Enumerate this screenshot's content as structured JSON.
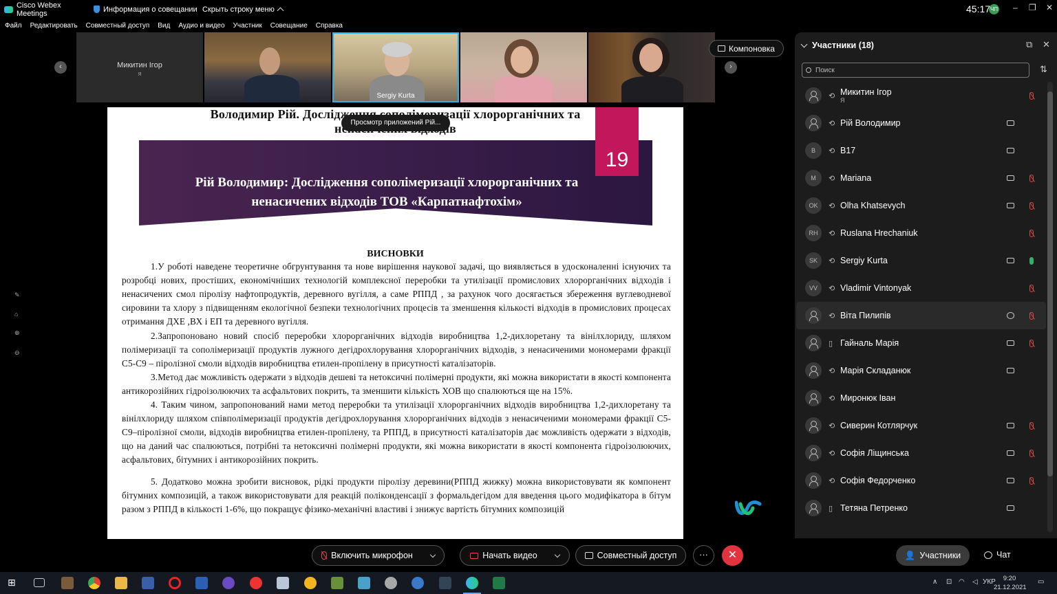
{
  "titlebar": {
    "app": "Cisco Webex Meetings",
    "info": "Информация о совещании",
    "hide_menu": "Скрыть строку меню",
    "time": "45:17",
    "rec_badge": "ЧП"
  },
  "menu": [
    "Файл",
    "Редактировать",
    "Совместный доступ",
    "Вид",
    "Аудио и видео",
    "Участник",
    "Совещание",
    "Справка"
  ],
  "videos": {
    "tile1_name": "Микитин Ігор",
    "tile1_sub": "Я",
    "tile3_name": "Sergiy Kurta"
  },
  "layout_button": "Компоновка",
  "tooltip": "Просмотр приложений Рій...",
  "slide": {
    "top_title_1": "Володимир Рій. Дослідження сополімеризації хлорорганічних та",
    "top_title_2": "ненасичених відходів",
    "number": "19",
    "banner_1": "Рій Володимир: Дослідження сополімеризації хлорорганічних та",
    "banner_2": "ненасичених відходів  ТОВ «Карпатнафтохім»",
    "conclusions": "ВИСНОВКИ",
    "p1": "1.У роботі наведене теоретичне обгрунтування та нове вирішення наукової задачі, що виявляється в удосконаленні існуючих та розробці нових, простіших, економічніших технологій комплексної переробки та  утилізації промислових хлорорганічних відходів  і ненасичених смол піролізу нафтопродуктів, деревного вугілля, а саме РППД , за рахунок чого досягається збереження вуглеводневої сировини та хлору з підвищенням екологічної безпеки технологічних процесів та зменшення кількості відходів в промислових процесах отримання ДХЕ ,ВХ і ЕП та деревного вугілля.",
    "p2": "2.Запропоновано новий спосіб переробки хлорорганічних відходів виробництва 1,2-дихлоретану та вінілхлориду, шляхом полімеризації та сополімеризації продуктів лужного дегідрохлорування хлорорганічних відходів, з  ненасиченими мономерами фракції C5-C9 – піролізної смоли відходів виробництва етилен-пропілену в присутності каталізаторів.",
    "p3": "3.Метод дає можливість одержати з відходів дешеві та нетоксичні полімерні продукти, які  можна використати в якості компонента антикорозійних гідроізолюючих та асфальтових покрить, та зменшити кількість ХОВ що спалюються ще на 15%.",
    "p4": "4. Таким чином, запропонований нами метод переробки та утилізації хлорорганічних відходів виробництва 1,2-дихлоретану та вінілхлориду шляхом співполімеризації продуктів дегідрохлорування хлорорганічних відходів з ненасиченими мономерами фракції C5-C9–піролізної смоли, відходів виробництва етилен-пропілену, та РППД, в присутності каталізаторів дає можливість одержати з відходів, що на даний час спалюються, потрібні та нетоксичні полімерні продукти, які  можна використати в якості компонента гідроізолюючих,  асфальтових, бітумних   і антикорозійних покрить.",
    "p5": "5. Додатково можна зробити висновок, рідкі продукти піролізу деревини(РППД жижку) можна використовувати як компонент бітумних композицій, а також використовувати для реакцій поліконденсації з формальдегідом для введення цього модифікатора в бітум разом з  РППД в кількості 1-6%, що покращує фізико-механічні властиві і знижує вартість бітумних композицій"
  },
  "panel": {
    "title": "Участники (18)",
    "search_placeholder": "Поиск",
    "participants": [
      {
        "initials": "",
        "name": "Микитин Ігор",
        "sub": "Я",
        "device": "headset",
        "cam": false,
        "mic": "muted"
      },
      {
        "initials": "",
        "name": "Рій Володимир",
        "sub": "",
        "device": "headset",
        "cam": true,
        "mic": "none"
      },
      {
        "initials": "B",
        "name": "B17",
        "sub": "",
        "device": "headset",
        "cam": true,
        "mic": "none"
      },
      {
        "initials": "M",
        "name": "Mariana",
        "sub": "",
        "device": "headset",
        "cam": true,
        "mic": "muted"
      },
      {
        "initials": "OK",
        "name": "Olha Khatsevych",
        "sub": "",
        "device": "headset",
        "cam": true,
        "mic": "muted"
      },
      {
        "initials": "RH",
        "name": "Ruslana Hrechaniuk",
        "sub": "",
        "device": "headset",
        "cam": false,
        "mic": "muted"
      },
      {
        "initials": "SK",
        "name": "Sergiy Kurta",
        "sub": "",
        "device": "headset",
        "cam": true,
        "mic": "on"
      },
      {
        "initials": "VV",
        "name": "Vladimir Vintonyak",
        "sub": "",
        "device": "headset",
        "cam": false,
        "mic": "muted"
      },
      {
        "initials": "",
        "name": "Віта Пилипів",
        "sub": "",
        "device": "headset",
        "cam": false,
        "chat": true,
        "mic": "muted"
      },
      {
        "initials": "",
        "name": "Гайналь Марія",
        "sub": "",
        "device": "phone",
        "cam": true,
        "mic": "muted"
      },
      {
        "initials": "",
        "name": "Марія Складанюк",
        "sub": "",
        "device": "headset",
        "cam": true,
        "mic": "none"
      },
      {
        "initials": "",
        "name": "Миронюк Іван",
        "sub": "",
        "device": "headset",
        "cam": false,
        "mic": "none"
      },
      {
        "initials": "",
        "name": "Сиверин Котлярчук",
        "sub": "",
        "device": "headset",
        "cam": true,
        "mic": "muted"
      },
      {
        "initials": "",
        "name": "Софія Ліщинська",
        "sub": "",
        "device": "headset",
        "cam": true,
        "mic": "muted"
      },
      {
        "initials": "",
        "name": "Софія Федорченко",
        "sub": "",
        "device": "headset",
        "cam": true,
        "mic": "muted"
      },
      {
        "initials": "",
        "name": "Тетяна Петренко",
        "sub": "",
        "device": "phone",
        "cam": true,
        "mic": "none"
      }
    ]
  },
  "controls": {
    "mic": "Включить микрофон",
    "video": "Начать видео",
    "share": "Совместный доступ",
    "participants": "Участники",
    "chat": "Чат"
  },
  "taskbar": {
    "lang": "УКР",
    "time": "9:20",
    "date": "21.12.2021"
  },
  "colors": {
    "accent": "#2bb1e6",
    "end_call": "#e33340",
    "muted": "#e0454f",
    "slide_pink": "#c2185b",
    "slide_banner": "#3d1f4c"
  }
}
